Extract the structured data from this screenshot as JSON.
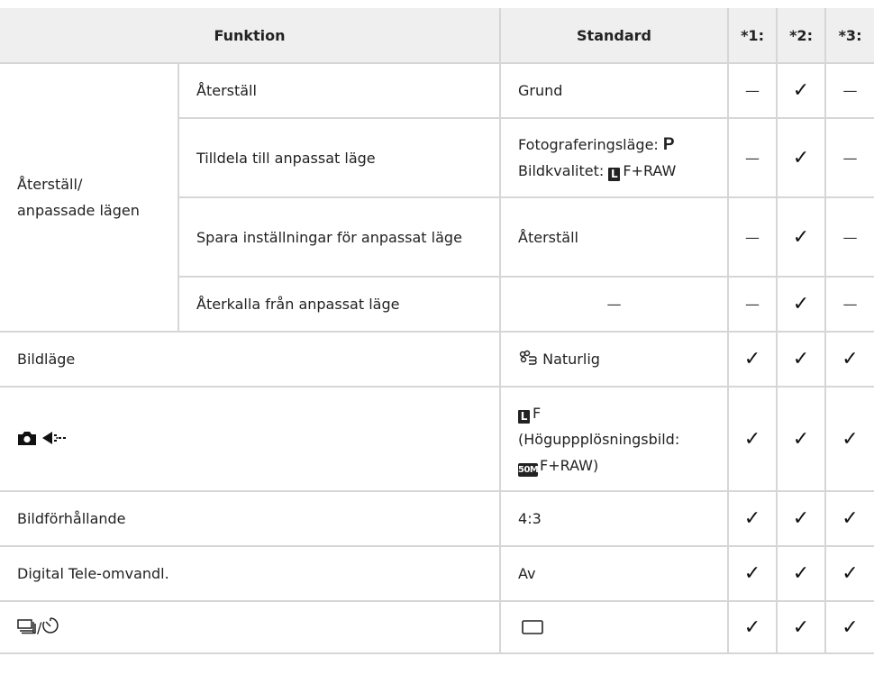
{
  "header": {
    "funktion": "Funktion",
    "standard": "Standard",
    "c1": "*1:",
    "c2": "*2:",
    "c3": "*3:"
  },
  "marks": {
    "check": "✓",
    "dash": "—"
  },
  "group": {
    "label": "Återställ/\nanpassade lägen"
  },
  "rows": {
    "reset": {
      "name": "Återställ",
      "std": "Grund"
    },
    "assign": {
      "name": "Tilldela till anpassat läge",
      "std_line1_prefix": "Fotograferingsläge: ",
      "std_line1_mode": "P",
      "std_line2_prefix": "Bildkvalitet: ",
      "std_line2_icon": "L",
      "std_line2_suffix": "F+RAW"
    },
    "save": {
      "name": "Spara inställningar för anpassat läge",
      "std": "Återställ"
    },
    "recall": {
      "name": "Återkalla från anpassat läge",
      "std": "—"
    },
    "picture": {
      "name": "Bildläge",
      "std_icon": "picture-mode-natural-icon",
      "std": "Naturlig"
    },
    "quality": {
      "name_icons": [
        "camera-icon",
        "image-quality-icon"
      ],
      "std_icon": "L",
      "std_line1": "F",
      "std_line2": "(Höguppplösningsbild:",
      "std_line3_icon": "50M",
      "std_line3": "F+RAW)"
    },
    "aspect": {
      "name": "Bildförhållande",
      "std": "4:3"
    },
    "tele": {
      "name": "Digital Tele-omvandl.",
      "std": "Av"
    },
    "drive": {
      "name_icons": [
        "sequential-drive-icon",
        "self-timer-icon"
      ],
      "name_sep": "/",
      "std_icon": "single-frame-icon"
    }
  }
}
